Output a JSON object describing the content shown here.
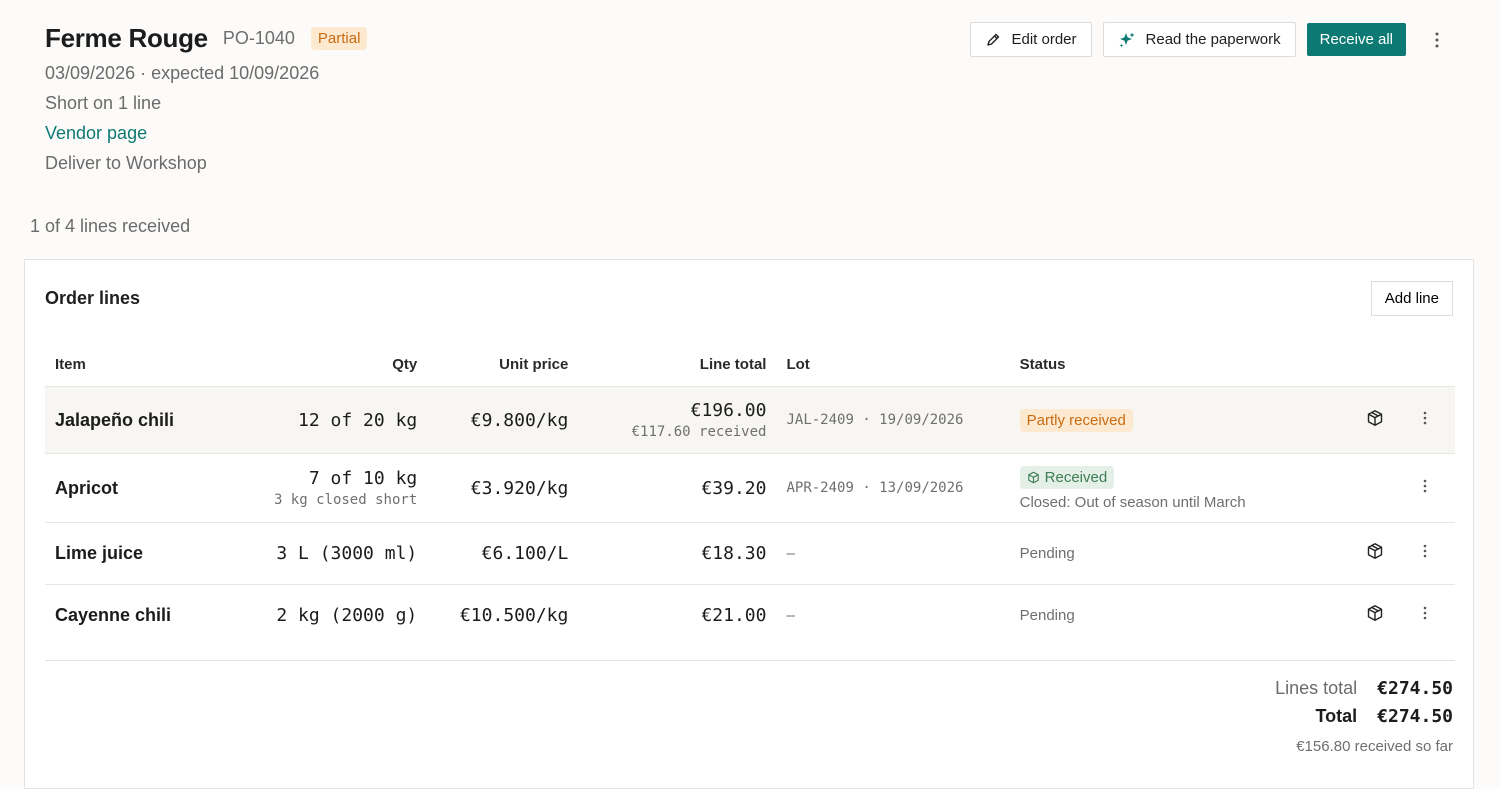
{
  "header": {
    "vendor_name": "Ferme Rouge",
    "po_number": "PO-1040",
    "status_badge": "Partial",
    "dates": "03/09/2026 · expected 10/09/2026",
    "short_note": "Short on 1 line",
    "vendor_link": "Vendor page",
    "deliver_to": "Deliver to Workshop"
  },
  "actions": {
    "edit_order": "Edit order",
    "read_paperwork": "Read the paperwork",
    "receive_all": "Receive all"
  },
  "progress": "1 of 4 lines received",
  "card": {
    "title": "Order lines",
    "add_line": "Add line",
    "columns": {
      "item": "Item",
      "qty": "Qty",
      "unit_price": "Unit price",
      "line_total": "Line total",
      "lot": "Lot",
      "status": "Status"
    },
    "rows": [
      {
        "item": "Jalapeño chili",
        "qty": "12 of 20 kg",
        "unit_price": "€9.800/kg",
        "line_total": "€196.00",
        "line_total_sub": "€117.60 received",
        "lot": "JAL-2409 · 19/09/2026",
        "status": "Partly received"
      },
      {
        "item": "Apricot",
        "qty": "7 of 10 kg",
        "qty_sub": "3 kg closed short",
        "unit_price": "€3.920/kg",
        "line_total": "€39.20",
        "lot": "APR-2409 · 13/09/2026",
        "status": "Received",
        "status_note": "Closed: Out of season until March"
      },
      {
        "item": "Lime juice",
        "qty": "3 L (3000 ml)",
        "unit_price": "€6.100/L",
        "line_total": "€18.30",
        "lot": "—",
        "status": "Pending"
      },
      {
        "item": "Cayenne chili",
        "qty": "2 kg (2000 g)",
        "unit_price": "€10.500/kg",
        "line_total": "€21.00",
        "lot": "—",
        "status": "Pending"
      }
    ],
    "totals": {
      "lines_total_label": "Lines total",
      "lines_total_value": "€274.50",
      "total_label": "Total",
      "total_value": "€274.50",
      "received_note": "€156.80 received so far"
    }
  },
  "icons": [
    "pencil-icon",
    "sparkle-icon",
    "kebab-icon",
    "package-icon"
  ],
  "colors": {
    "accent": "#0c7a72",
    "partial_bg": "#fde9cf",
    "partial_fg": "#c96b12",
    "received_bg": "#e3efe7",
    "received_fg": "#3e7d55"
  }
}
